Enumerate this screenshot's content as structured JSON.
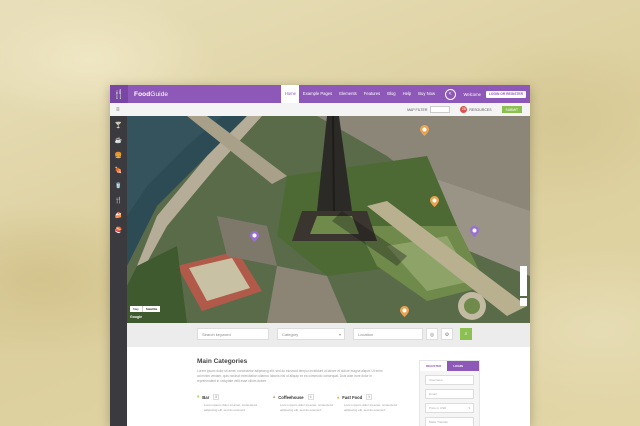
{
  "brand": {
    "name_bold": "Food",
    "name_light": "Guide"
  },
  "nav": {
    "items": [
      "Home",
      "Example Pages",
      "Elements",
      "Features",
      "Blog",
      "Help",
      "Buy Now"
    ],
    "active_index": 0,
    "welcome": "Welcome",
    "login_button": "LOGIN OR REGISTER"
  },
  "subbar": {
    "map_filter_label": "MAP FILTER",
    "filter_value": "",
    "resources_count": "26",
    "resources_label": "RESOURCES",
    "submit_label": "SUBMIT"
  },
  "map": {
    "google_label": "Google",
    "map_toggle": "Map",
    "satellite_toggle": "Satellite"
  },
  "search": {
    "keyword_placeholder": "Search keyword",
    "category_placeholder": "Category",
    "location_placeholder": "Location"
  },
  "content": {
    "heading": "Main Categories",
    "paragraph": "Lorem ipsum dolor sit amet, consectetur adipiscing elit, sed do eiusmod tempor incididunt ut labore et dolore magna aliqua. Ut enim ad minim veniam, quis nostrud exercitation ullamco laboris nisi ut aliquip ex ea commodo consequat. Duis aute irure dolor in reprehenderit in voluptate velit esse cillum dolore.",
    "categories": [
      {
        "name": "Bar",
        "count": "8",
        "desc": "Lorem ipsum dolor sit amet, consectetur adipiscing elit, sed do eiusmod."
      },
      {
        "name": "Coffeehouse",
        "count": "6",
        "desc": "Lorem ipsum dolor sit amet, consectetur adipiscing elit, sed do eiusmod."
      },
      {
        "name": "Fast Food",
        "count": "5",
        "desc": "Lorem ipsum dolor sit amet, consectetur adipiscing elit, sed do eiusmod."
      }
    ]
  },
  "login_panel": {
    "tab_register": "REGISTER",
    "tab_login": "LOGIN",
    "fields": [
      "Username",
      "Email",
      "Price in USD",
      "Make Transfer"
    ]
  },
  "colors": {
    "brand_purple": "#8e58b8",
    "accent_green": "#8cc152",
    "sidebar_dark": "#3a3a3f",
    "badge_red": "#d9534f"
  },
  "icons": {
    "sidebar": [
      "cocktail-icon",
      "coffee-icon",
      "burger-icon",
      "meat-icon",
      "drink-icon",
      "cutlery-icon",
      "cake-icon",
      "sushi-icon"
    ],
    "pins": [
      "map-pin-orange",
      "map-pin-orange",
      "map-pin-purple",
      "map-pin-purple",
      "map-pin-orange"
    ]
  }
}
